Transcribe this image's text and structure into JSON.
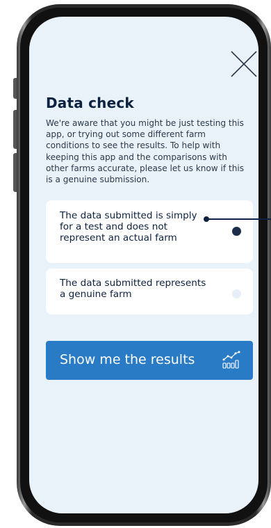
{
  "modal": {
    "title": "Data check",
    "description": "We're aware that you might be just testing this app, or trying out some different farm conditions to see the results. To help with keeping this app and the comparisons with other farms accurate, please let us know if this is a genuine submission.",
    "close_icon": "close-icon"
  },
  "options": [
    {
      "label": "The data submitted is simply for a test and does not represent an actual farm",
      "selected": true
    },
    {
      "label": "The data submitted represents a genuine farm",
      "selected": false
    }
  ],
  "cta": {
    "label": "Show me the results",
    "icon": "chart-growth-icon"
  },
  "colors": {
    "screen_bg": "#e9f1f9",
    "title": "#0d2240",
    "cta_bg": "#2a7bc6",
    "selected_radio": "#1b2d4a"
  }
}
